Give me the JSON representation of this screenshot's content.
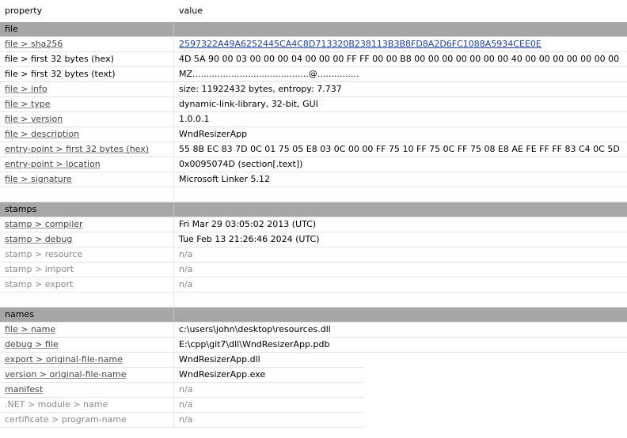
{
  "columns": {
    "property": "property",
    "value": "value"
  },
  "sections": [
    {
      "label": "file",
      "rows": [
        {
          "prop": "file > sha256",
          "value": "2597322A49A6252445CA4C8D713320B238113B3B8FD8A2D6FC1088A5934CEE0E",
          "style": "link",
          "vstyle": "hash"
        },
        {
          "prop": "file > first 32 bytes (hex)",
          "value": "4D 5A 90 00 03 00 00 00 04 00 00 00 FF FF 00 00 B8 00 00 00 00 00 00 00 40 00 00 00 00 00 00 00",
          "style": "plain"
        },
        {
          "prop": "file > first 32 bytes (text)",
          "value": "MZ..........................................@...............",
          "style": "plain"
        },
        {
          "prop": "file > info",
          "value": "size: 11922432 bytes, entropy: 7.737",
          "style": "link"
        },
        {
          "prop": "file > type",
          "value": "dynamic-link-library, 32-bit, GUI",
          "style": "link"
        },
        {
          "prop": "file > version",
          "value": "1.0.0.1",
          "style": "link"
        },
        {
          "prop": "file > description",
          "value": "WndResizerApp",
          "style": "link"
        },
        {
          "prop": "entry-point > first 32 bytes (hex)",
          "value": "55 8B EC 83 7D 0C 01 75 05 E8 03 0C 00 00 FF 75 10 FF 75 0C FF 75 08 E8 AE FE FF FF 83 C4 0C 5D",
          "style": "link"
        },
        {
          "prop": "entry-point > location",
          "value": "0x0095074D (section[.text])",
          "style": "link"
        },
        {
          "prop": "file > signature",
          "value": "Microsoft Linker 5.12",
          "style": "link"
        }
      ]
    },
    {
      "label": "stamps",
      "rows": [
        {
          "prop": "stamp > compiler",
          "value": "Fri Mar 29 03:05:02 2013 (UTC)",
          "style": "link"
        },
        {
          "prop": "stamp > debug",
          "value": "Tue Feb 13 21:26:46 2024 (UTC)",
          "style": "link"
        },
        {
          "prop": "stamp > resource",
          "value": "n/a",
          "style": "muted"
        },
        {
          "prop": "stamp > import",
          "value": "n/a",
          "style": "muted"
        },
        {
          "prop": "stamp > export",
          "value": "n/a",
          "style": "muted"
        }
      ]
    },
    {
      "label": "names",
      "rows": [
        {
          "prop": "file > name",
          "value": "c:\\users\\john\\desktop\\resources.dll",
          "style": "link"
        },
        {
          "prop": "debug > file",
          "value": "E:\\cpp\\git7\\dll\\WndResizerApp.pdb",
          "style": "link"
        },
        {
          "prop": "export > original-file-name",
          "value": "WndResizerApp.dll",
          "style": "link",
          "short": true
        },
        {
          "prop": "version > original-file-name",
          "value": "WndResizerApp.exe",
          "style": "link",
          "short": true
        },
        {
          "prop": "manifest",
          "value": "n/a",
          "style": "link",
          "vstyle": "muted",
          "short": true
        },
        {
          "prop": ".NET > module > name",
          "value": "n/a",
          "style": "muted",
          "short": true
        },
        {
          "prop": "certificate > program-name",
          "value": "n/a",
          "style": "muted",
          "short": true
        }
      ]
    }
  ]
}
